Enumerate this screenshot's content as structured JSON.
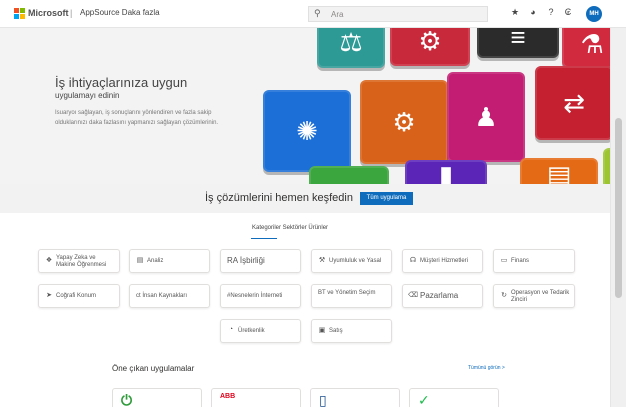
{
  "header": {
    "brand": "Microsoft",
    "separator": "|",
    "product": "AppSource Daka fazla",
    "search_placeholder": "Ara",
    "search_icon": "⚲",
    "icons": [
      {
        "name": "star-icon",
        "glyph": "★"
      },
      {
        "name": "globe-icon",
        "glyph": "◕"
      },
      {
        "name": "help-icon",
        "glyph": "?"
      },
      {
        "name": "settings-icon",
        "glyph": "₢"
      }
    ],
    "avatar_initials": "MH",
    "logo_colors": [
      "#f25022",
      "#7fba00",
      "#00a4ef",
      "#ffb900"
    ]
  },
  "hero": {
    "title": "İş ihtiyaçlarınıza uygun",
    "subtitle": "uygulamayı edinin",
    "description": "Isuaryoı sağlayan, iş sonuçlarını yönlendiren ve fazla sakip olduklarınızı daka fazlasını yapmanızı sağlayan çözümlerinin.",
    "keys": [
      {
        "name": "scales-key",
        "color": "#2e9a95",
        "glyph": "⚖"
      },
      {
        "name": "settings-key",
        "color": "#c92a3b",
        "glyph": "⚙"
      },
      {
        "name": "chart-key",
        "color": "#2b2b2b",
        "glyph": "≡"
      },
      {
        "name": "flask-key",
        "color": "#d12a3f",
        "glyph": "⚗"
      },
      {
        "name": "lightbulb-key",
        "color": "#1b6fd6",
        "glyph": "✺"
      },
      {
        "name": "gear-key",
        "color": "#d9621a",
        "glyph": "⚙"
      },
      {
        "name": "person-chart-key",
        "color": "#c21d72",
        "glyph": "♟"
      },
      {
        "name": "people-key",
        "color": "#c42030",
        "glyph": "⇄"
      },
      {
        "name": "green-key",
        "color": "#3aa63d",
        "glyph": ""
      },
      {
        "name": "bar-chart-key",
        "color": "#5b25b8",
        "glyph": "▮"
      },
      {
        "name": "document-key",
        "color": "#e46a16",
        "glyph": "▤"
      },
      {
        "name": "lime-key",
        "color": "#9cc531",
        "glyph": ""
      }
    ]
  },
  "explore": {
    "text": "İş çözümlerini hemen keşfedin",
    "button_label": "Tüm uygulama"
  },
  "tab_label": "Kategoriler Sektörler Ürünler",
  "categories": [
    {
      "name": "category-yapay-zeka",
      "icon_name": "brain-icon",
      "icon": "❖",
      "label": "Yapay Zeka ve Makine Öğrenmesi",
      "style": "two"
    },
    {
      "name": "category-analiz",
      "icon_name": "analytics-icon",
      "icon": "▤",
      "label": "Analiz",
      "style": "one"
    },
    {
      "name": "category-ra-isbirligi",
      "icon_name": "",
      "icon": "",
      "label": "RA İşbirliği",
      "style": "big"
    },
    {
      "name": "category-uyumluluk",
      "icon_name": "hammer-icon",
      "icon": "⚒",
      "label": "Uyumluluk ve Yasal",
      "style": "one"
    },
    {
      "name": "category-musteri-hizmetleri",
      "icon_name": "headset-icon",
      "icon": "☊",
      "label": "Müşteri Hizmetleri",
      "style": "one"
    },
    {
      "name": "category-finans",
      "icon_name": "finance-icon",
      "icon": "▭",
      "label": "Finans",
      "style": "one"
    },
    {
      "name": "category-cografi-konum",
      "icon_name": "location-icon",
      "icon": "➤",
      "label": "Coğrafi Konum",
      "style": "one"
    },
    {
      "name": "category-insan-kaynaklari",
      "icon_name": "",
      "icon": "",
      "label": "ct İnsan Kaynakları",
      "style": "one"
    },
    {
      "name": "category-nesnelerin-interneti",
      "icon_name": "",
      "icon": "",
      "label": "#Nesnelerin İnterneti",
      "style": "one"
    },
    {
      "name": "category-bt-yonetim",
      "icon_name": "",
      "icon": "",
      "label": "BT ve Yönetim Seçim",
      "style": "two"
    },
    {
      "name": "category-pazarlama",
      "icon_name": "tag-icon",
      "icon": "⌫",
      "label": "Pazarlama",
      "style": "big"
    },
    {
      "name": "category-operasyon",
      "icon_name": "refresh-icon",
      "icon": "↻",
      "label": "Operasyon ve Tedarik Zinciri",
      "style": "two"
    },
    {
      "name": "category-uretkenlik",
      "icon_name": "clock-icon",
      "icon": "◔",
      "label": "Üretkenlik",
      "style": "one"
    },
    {
      "name": "category-satis",
      "icon_name": "bag-icon",
      "icon": "▣",
      "label": "Satış",
      "style": "one"
    }
  ],
  "featured": {
    "title": "Öne çıkan uygulamalar",
    "see_more": "Tümünü görün >",
    "apps": [
      {
        "name": "app-tile-power",
        "icon": "⏻",
        "color": "#2e9c3a",
        "text": ""
      },
      {
        "name": "app-tile-abb",
        "icon": "",
        "color": "#e2001a",
        "text": "ABB"
      },
      {
        "name": "app-tile-document",
        "icon": "▯",
        "color": "#1d4f91",
        "text": ""
      },
      {
        "name": "app-tile-check",
        "icon": "✓",
        "color": "#1dbb4d",
        "text": ""
      }
    ]
  }
}
